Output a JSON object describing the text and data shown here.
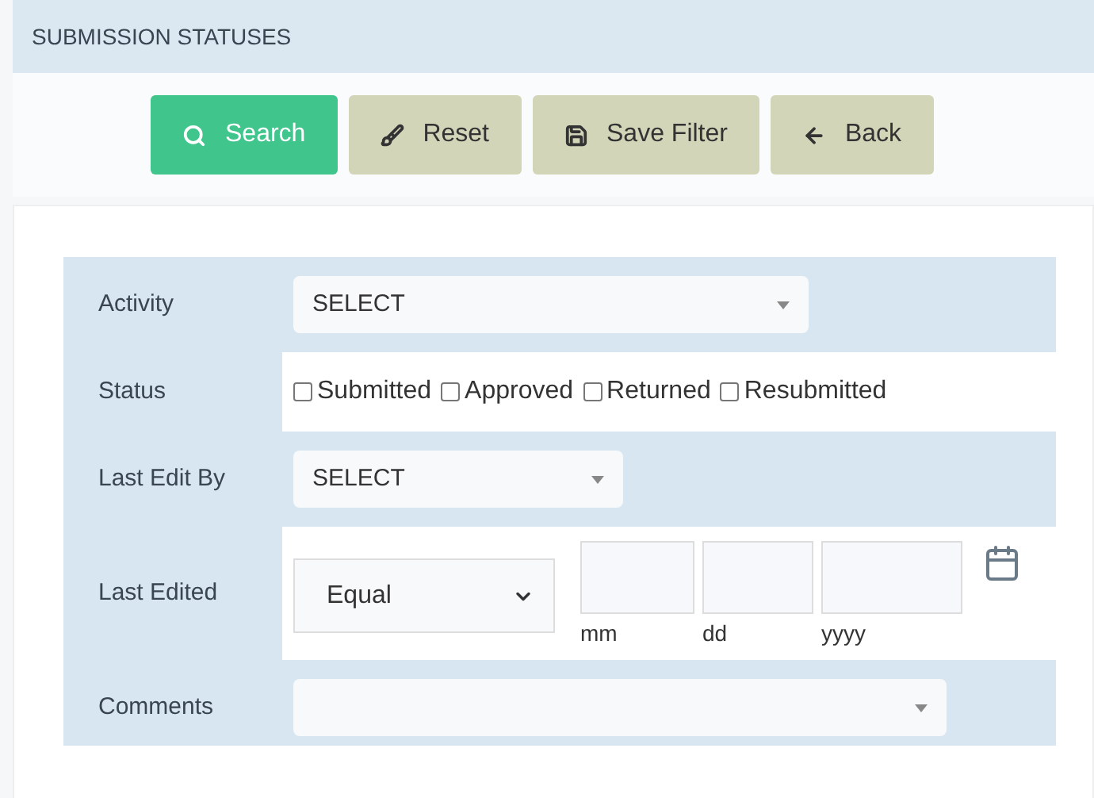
{
  "header": {
    "title": "SUBMISSION STATUSES"
  },
  "buttons": [
    {
      "label": "Search",
      "kind": "primary"
    },
    {
      "label": "Reset",
      "kind": "secondary"
    },
    {
      "label": "Save Filter",
      "kind": "secondary"
    },
    {
      "label": "Back",
      "kind": "secondary"
    }
  ],
  "fields": [
    {
      "label": "Activity",
      "kind": "select",
      "value": "SELECT"
    },
    {
      "label": "Status",
      "kind": "checkboxes",
      "options": [
        {
          "label": "Submitted",
          "checked": false
        },
        {
          "label": "Approved",
          "checked": false
        },
        {
          "label": "Returned",
          "checked": false
        },
        {
          "label": "Resubmitted",
          "checked": false
        }
      ]
    },
    {
      "label": "Last Edit By",
      "kind": "select",
      "value": "SELECT"
    },
    {
      "label": "Last Edited",
      "kind": "date",
      "operator": "Equal",
      "parts": [
        "mm",
        "dd",
        "yyyy"
      ]
    },
    {
      "label": "Comments",
      "kind": "select"
    }
  ]
}
